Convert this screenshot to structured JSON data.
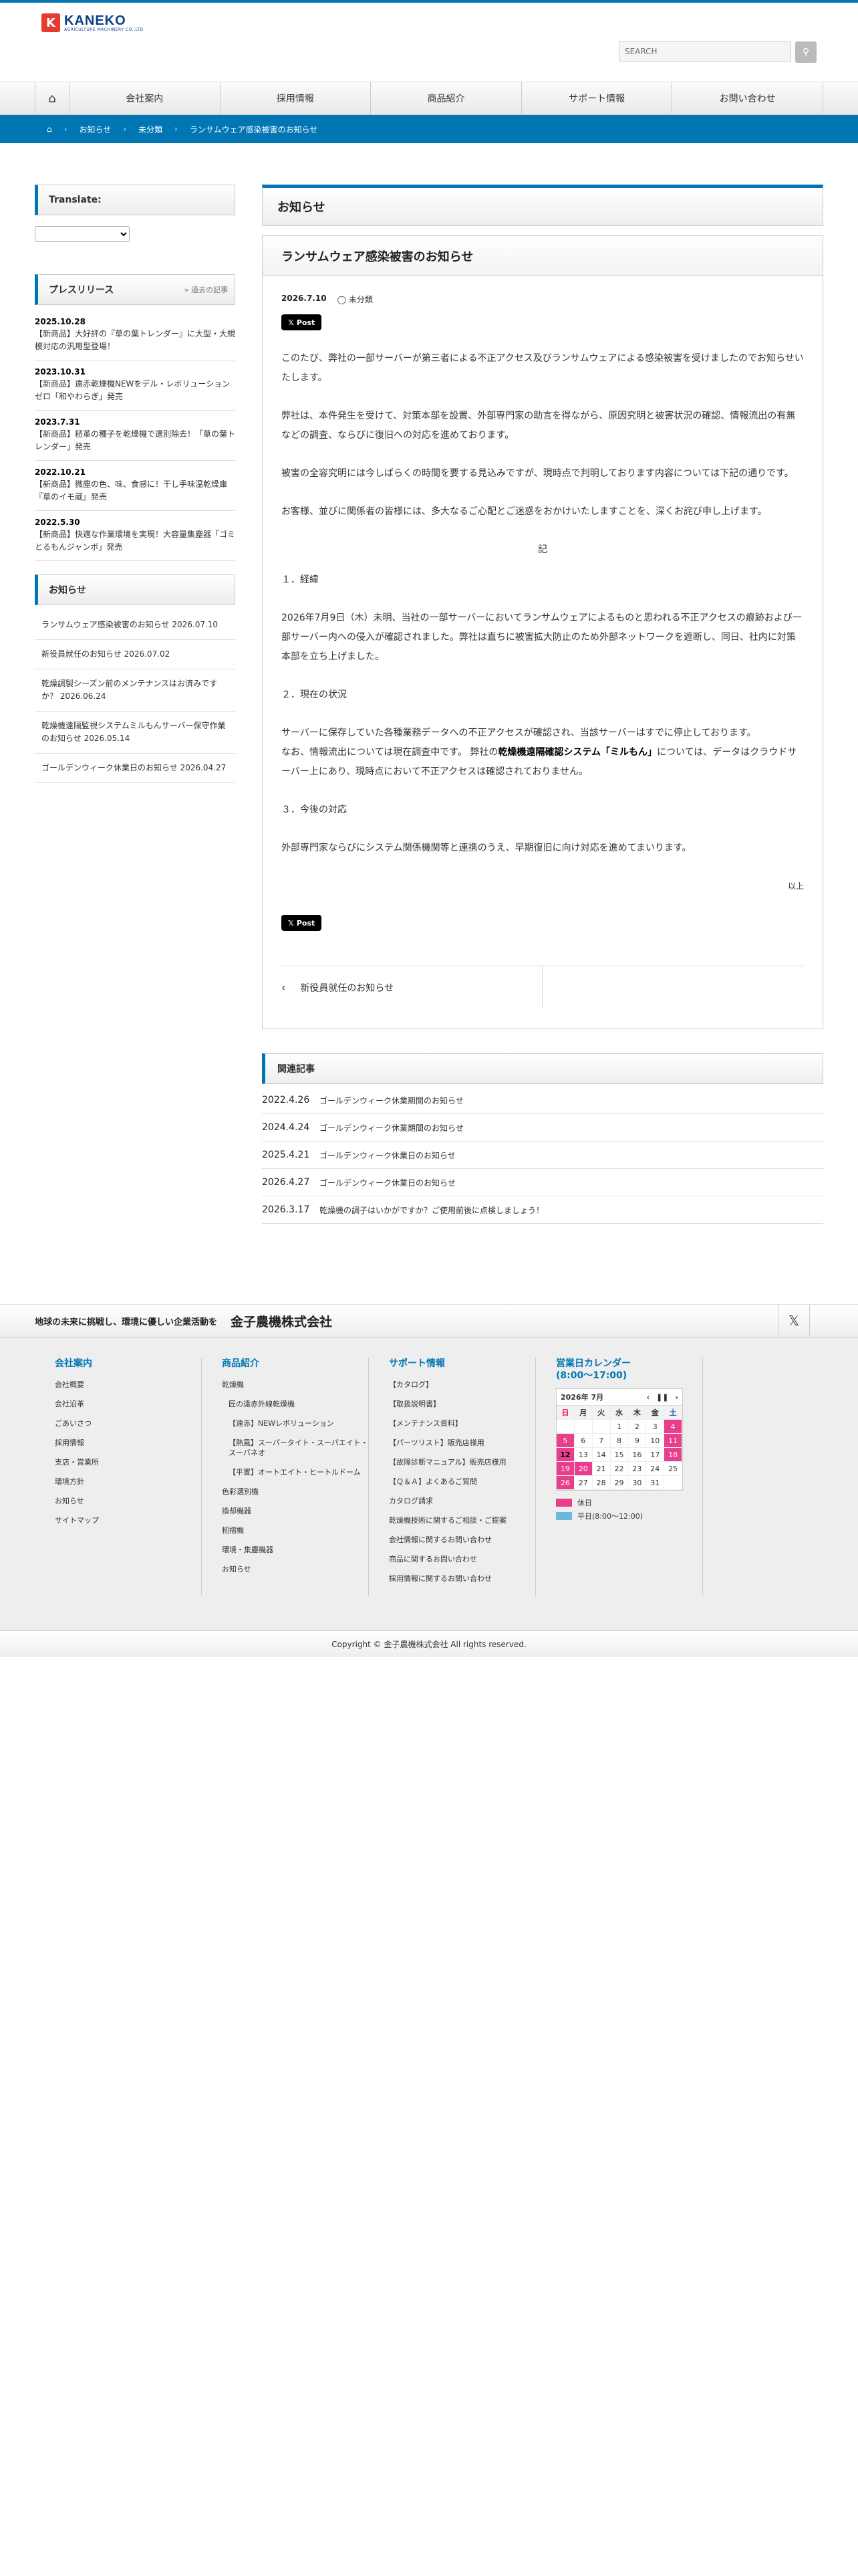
{
  "header": {
    "logo_name": "KANEKO",
    "logo_sub": "AGRICULTURE MACHINERY CO.,LTD",
    "search_placeholder": "SEARCH"
  },
  "nav": {
    "items": [
      "会社案内",
      "採用情報",
      "商品紹介",
      "サポート情報",
      "お問い合わせ"
    ]
  },
  "breadcrumb": [
    "お知らせ",
    "未分類",
    "ランサムウェア感染被害のお知らせ"
  ],
  "sidebar": {
    "translate_title": "Translate:",
    "press_title": "プレスリリース",
    "press_more": "» 過去の記事",
    "press_items": [
      {
        "date": "2025.10.28",
        "title": "【新商品】大好評の『草の葉トレンダー』に大型・大規模対応の汎用型登場！"
      },
      {
        "date": "2023.10.31",
        "title": "【新商品】遠赤乾燥機NEWをデル・レボリューションゼロ「和やわらぎ」発売"
      },
      {
        "date": "2023.7.31",
        "title": "【新商品】籾革の種子を乾燥機で選別除去！「草の葉トレンダー」発売"
      },
      {
        "date": "2022.10.21",
        "title": "【新商品】微塵の色、味、食感に！干し手味温乾燥庫『草のイモ蔵』発売"
      },
      {
        "date": "2022.5.30",
        "title": "【新商品】快適な作業環境を実現！大容量集塵器「ゴミとるもんジャンボ」発売"
      }
    ],
    "news_title": "お知らせ",
    "news_items": [
      "ランサムウェア感染被害のお知らせ 2026.07.10",
      "新役員就任のお知らせ 2026.07.02",
      "乾燥調製シーズン前のメンテナンスはお済みですか？ 2026.06.24",
      "乾燥機遠隔監視システムミルもんサーバー保守作業のお知らせ 2026.05.14",
      "ゴールデンウィーク休業日のお知らせ 2026.04.27"
    ]
  },
  "content": {
    "section_title": "お知らせ",
    "article_title": "ランサムウェア感染被害のお知らせ",
    "date": "2026.7.10",
    "category": "未分類",
    "post_label": "Post",
    "p1": "このたび、弊社の一部サーバーが第三者による不正アクセス及びランサムウェアによる感染被害を受けましたのでお知らせいたします。",
    "p2": "弊社は、本件発生を受けて、対策本部を設置、外部専門家の助言を得ながら、原因究明と被害状況の確認、情報流出の有無などの調査、ならびに復旧への対応を進めております。",
    "p3": "被害の全容究明には今しばらくの時間を要する見込みですが、現時点で判明しております内容については下記の通りです。",
    "p4": "お客様、並びに関係者の皆様には、多大なるご心配とご迷惑をおかけいたしますことを、深くお詫び申し上げます。",
    "ki": "記",
    "h1": "１．経緯",
    "p5": "2026年7月9日（木）未明、当社の一部サーバーにおいてランサムウェアによるものと思われる不正アクセスの痕跡および一部サーバー内への侵入が確認されました。弊社は直ちに被害拡大防止のため外部ネットワークを遮断し、同日、社内に対策本部を立ち上げました。",
    "h2": "２．現在の状況",
    "p6a": "サーバーに保存していた各種業務データへの不正アクセスが確認され、当該サーバーはすでに停止しております。",
    "p6b_pre": "なお、情報流出については現在調査中です。 弊社の",
    "p6b_bold": "乾燥機遠隔確認システム「ミルもん」",
    "p6b_post": "については、データはクラウドサーバー上にあり、現時点において不正アクセスは確認されておりません。",
    "h3": "３．今後の対応",
    "p7": "外部専門家ならびにシステム関係機関等と連携のうえ、早期復旧に向け対応を進めてまいります。",
    "ijo": "以上",
    "post_label2": "Post",
    "prev_post": "新役員就任のお知らせ",
    "related_title": "関連記事",
    "related": [
      {
        "date": "2022.4.26",
        "title": "ゴールデンウィーク休業期間のお知らせ"
      },
      {
        "date": "2024.4.24",
        "title": "ゴールデンウィーク休業期間のお知らせ"
      },
      {
        "date": "2025.4.21",
        "title": "ゴールデンウィーク休業日のお知らせ"
      },
      {
        "date": "2026.4.27",
        "title": "ゴールデンウィーク休業日のお知らせ"
      },
      {
        "date": "2026.3.17",
        "title": "乾燥機の調子はいかがですか？ご使用前後に点検しましょう！"
      }
    ]
  },
  "footer": {
    "tagline": "地球の未来に挑戦し、環境に優しい企業活動を",
    "company": "金子農機株式会社",
    "col1_title": "会社案内",
    "col1": [
      "会社概要",
      "会社沿革",
      "ごあいさつ",
      "採用情報",
      "支店・営業所",
      "環境方針",
      "お知らせ",
      "サイトマップ"
    ],
    "col2_title": "商品紹介",
    "col2": [
      {
        "t": "乾燥機",
        "sub": false
      },
      {
        "t": "匠の遠赤外線乾燥機",
        "sub": true
      },
      {
        "t": "【遠赤】NEWレボリューション",
        "sub": true
      },
      {
        "t": "【熱風】スーパータイト・スーパエイト・スーパネオ",
        "sub": true
      },
      {
        "t": "【平置】オートエイト・ヒートルドーム",
        "sub": true
      },
      {
        "t": "色彩選別機",
        "sub": false
      },
      {
        "t": "換却機器",
        "sub": false
      },
      {
        "t": "籾摺機",
        "sub": false
      },
      {
        "t": "環境・集塵機器",
        "sub": false
      },
      {
        "t": "お知らせ",
        "sub": false
      }
    ],
    "col3_title": "サポート情報",
    "col3": [
      "【カタログ】",
      "【取扱説明書】",
      "【メンテナンス資料】",
      "【パーツリスト】販売店様用",
      "【故障診断マニュアル】販売店様用",
      "【Ｑ＆Ａ】よくあるご質問",
      "カタログ請求",
      "乾燥機技術に関するご相談・ご提案",
      "会社情報に関するお問い合わせ",
      "商品に関するお問い合わせ",
      "採用情報に関するお問い合わせ"
    ],
    "col4_title": "営業日カレンダー\n(8:00〜17:00)",
    "cal_month": "2026年 7月",
    "cal_dow": [
      "日",
      "月",
      "火",
      "水",
      "木",
      "金",
      "土"
    ],
    "cal_days": [
      "",
      "",
      "",
      "1",
      "2",
      "3",
      "4",
      "5",
      "6",
      "7",
      "8",
      "9",
      "10",
      "11",
      "12",
      "13",
      "14",
      "15",
      "16",
      "17",
      "18",
      "19",
      "20",
      "21",
      "22",
      "23",
      "24",
      "25",
      "26",
      "27",
      "28",
      "29",
      "30",
      "31",
      ""
    ],
    "legend_holiday": "休日",
    "legend_short": "平日(8:00〜12:00)",
    "copyright": "Copyright ©  金子農機株式会社 All rights reserved.",
    "holiday_color": "#e83e8c",
    "short_color": "#6ab7e0"
  }
}
